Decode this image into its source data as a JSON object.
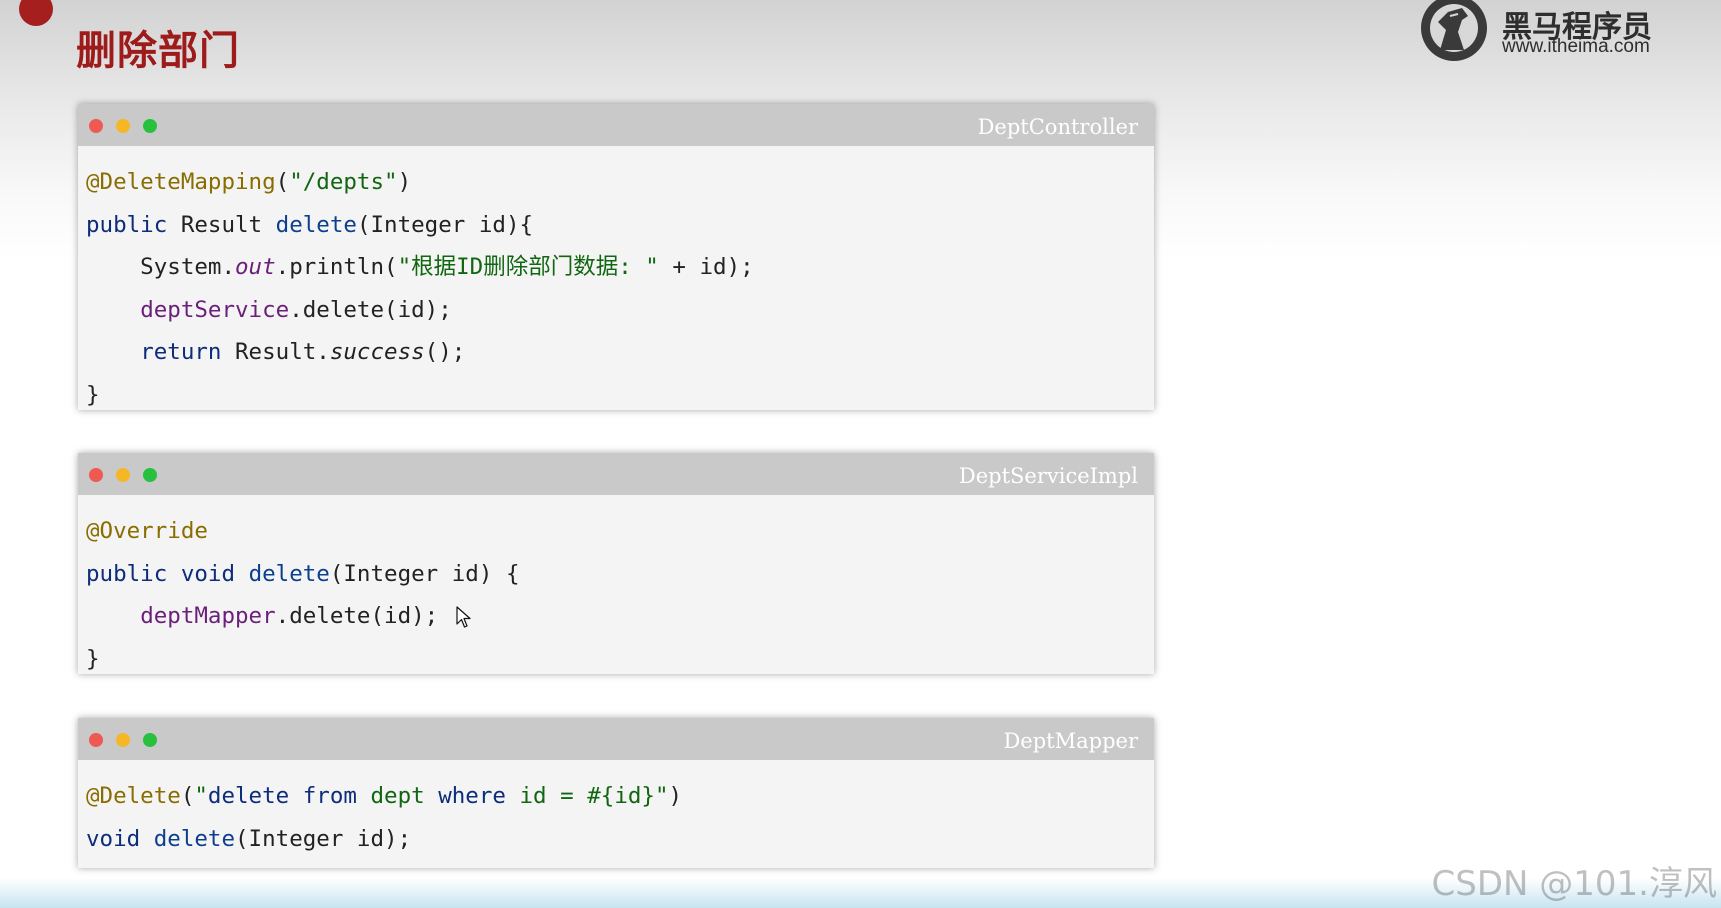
{
  "page": {
    "title": "删除部门"
  },
  "logo": {
    "name_cn": "黑马程序员",
    "url": "www.itheima.com",
    "icon": "horse-head-logo-icon"
  },
  "windows": [
    {
      "title": "DeptController",
      "lines": [
        [
          {
            "t": "@DeleteMapping",
            "c": "ann"
          },
          {
            "t": "(",
            "c": "plain"
          },
          {
            "t": "\"/depts\"",
            "c": "str"
          },
          {
            "t": ")",
            "c": "plain"
          }
        ],
        [
          {
            "t": "public",
            "c": "kw"
          },
          {
            "t": " Result ",
            "c": "plain"
          },
          {
            "t": "delete",
            "c": "fn"
          },
          {
            "t": "(Integer id){",
            "c": "plain"
          }
        ],
        [
          {
            "t": "    System.",
            "c": "plain"
          },
          {
            "t": "out",
            "c": "fld it"
          },
          {
            "t": ".println(",
            "c": "plain"
          },
          {
            "t": "\"根据ID删除部门数据: \"",
            "c": "str"
          },
          {
            "t": " + id);",
            "c": "plain"
          }
        ],
        [
          {
            "t": "    ",
            "c": "plain"
          },
          {
            "t": "deptService",
            "c": "fld"
          },
          {
            "t": ".delete(id);",
            "c": "plain"
          }
        ],
        [
          {
            "t": "    ",
            "c": "plain"
          },
          {
            "t": "return",
            "c": "kw"
          },
          {
            "t": " Result.",
            "c": "plain"
          },
          {
            "t": "success",
            "c": "it"
          },
          {
            "t": "();",
            "c": "plain"
          }
        ],
        [
          {
            "t": "}",
            "c": "plain"
          }
        ]
      ]
    },
    {
      "title": "DeptServiceImpl",
      "lines": [
        [
          {
            "t": "@Override",
            "c": "ann"
          }
        ],
        [
          {
            "t": "public",
            "c": "kw"
          },
          {
            "t": " ",
            "c": "plain"
          },
          {
            "t": "void",
            "c": "kw"
          },
          {
            "t": " ",
            "c": "plain"
          },
          {
            "t": "delete",
            "c": "fn"
          },
          {
            "t": "(Integer id) {",
            "c": "plain"
          }
        ],
        [
          {
            "t": "    ",
            "c": "plain"
          },
          {
            "t": "deptMapper",
            "c": "fld"
          },
          {
            "t": ".delete(id);",
            "c": "plain"
          }
        ],
        [
          {
            "t": "}",
            "c": "plain"
          }
        ]
      ]
    },
    {
      "title": "DeptMapper",
      "lines": [
        [
          {
            "t": "@Delete",
            "c": "ann"
          },
          {
            "t": "(",
            "c": "plain"
          },
          {
            "t": "\"",
            "c": "str"
          },
          {
            "t": "delete",
            "c": "kw"
          },
          {
            "t": " ",
            "c": "str"
          },
          {
            "t": "from",
            "c": "kw"
          },
          {
            "t": " dept ",
            "c": "str"
          },
          {
            "t": "where",
            "c": "kw"
          },
          {
            "t": " id = #{id}\"",
            "c": "str"
          },
          {
            "t": ")",
            "c": "plain"
          }
        ],
        [
          {
            "t": "void",
            "c": "kw"
          },
          {
            "t": " ",
            "c": "plain"
          },
          {
            "t": "delete",
            "c": "fn"
          },
          {
            "t": "(Integer id);",
            "c": "plain"
          }
        ]
      ]
    }
  ],
  "watermark": "CSDN @101.淳风",
  "colors": {
    "title_red": "#9e1b1b",
    "annotation": "#8a6d00",
    "keyword": "#0d2d7a",
    "method": "#0d3f8f",
    "field": "#6a1f7a",
    "string": "#116611",
    "titlebar": "#c9c9c9",
    "editor_bg": "#f4f4f4"
  }
}
